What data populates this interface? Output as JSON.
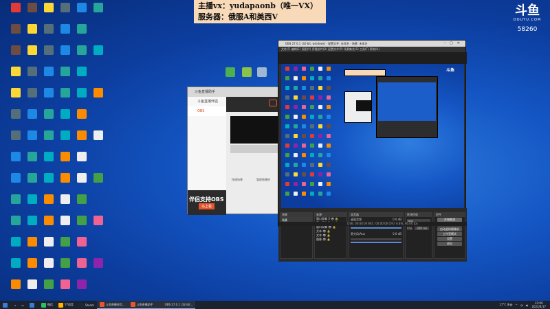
{
  "banner": {
    "line1": "主播vx：yudapaonb（唯一VX）",
    "line2": "服务器：俄服A和美西V"
  },
  "watermark": {
    "logo": "斗鱼",
    "domain": "DOUYU.COM",
    "room_id": "58260"
  },
  "douyu_helper": {
    "title": "斗鱼直播助手",
    "nav": [
      "斗鱼直播伴侣",
      "OBS"
    ],
    "ad_line1": "伴侣支持OBS",
    "ad_line2": "马上看",
    "links": [
      "快速场景",
      "管理直播间"
    ]
  },
  "obs": {
    "title": "OBS 27.0.1 (32-bit, windows) - 配置文件: 未命名 - 场景: 未命名",
    "menu": "文件(F)  编辑(E)  视图(V)  停靠部件(D)  配置文件(P)  场景集合(S)  工具(T)  帮助(H)",
    "docks": {
      "scenes": "场景",
      "sources": "来源",
      "mixer": "混音器",
      "transitions": "转场特效",
      "controls": "控件"
    },
    "scene_items": [
      "场景"
    ],
    "source_items": [
      "窗口采集 3",
      "窗口采集 2",
      "窗口采集",
      "文本",
      "文本",
      "图像"
    ],
    "mixer_items": [
      {
        "name": "桌面音频",
        "level": "0.0 dB"
      },
      {
        "name": "麦克风/Aux",
        "level": "0.0 dB"
      }
    ],
    "transition": {
      "type": "淡出",
      "duration_label": "时长",
      "duration": "300 ms"
    },
    "controls": [
      "开始推流",
      "开始录制",
      "启动虚拟摄像机",
      "工作室模式",
      "设置",
      "退出"
    ],
    "status": "LIVE: 00:00:00   REC: 00:00:00   CPU: 6.8%, 60.00 fps"
  },
  "taskbar": {
    "items": [
      {
        "label": "",
        "color": "#3a7bd5"
      },
      {
        "label": "微信",
        "color": "#2ac161"
      },
      {
        "label": "YY语音",
        "color": "#ffb400"
      },
      {
        "label": "Steam",
        "color": "#1b2838"
      },
      {
        "label": "斗鱼直播伴侣...",
        "color": "#e8542b"
      },
      {
        "label": "斗鱼直播助手",
        "color": "#e8542b"
      },
      {
        "label": "OBS 27.0.1 (32-bit...",
        "color": "#302e31"
      }
    ],
    "tray_temp": "17°C 多云",
    "time": "22:09",
    "date": "2022/4/17"
  },
  "colors": {
    "accent": "#e8542b",
    "banner_bg": "#f8d9b8",
    "desktop": "#1456c4"
  }
}
